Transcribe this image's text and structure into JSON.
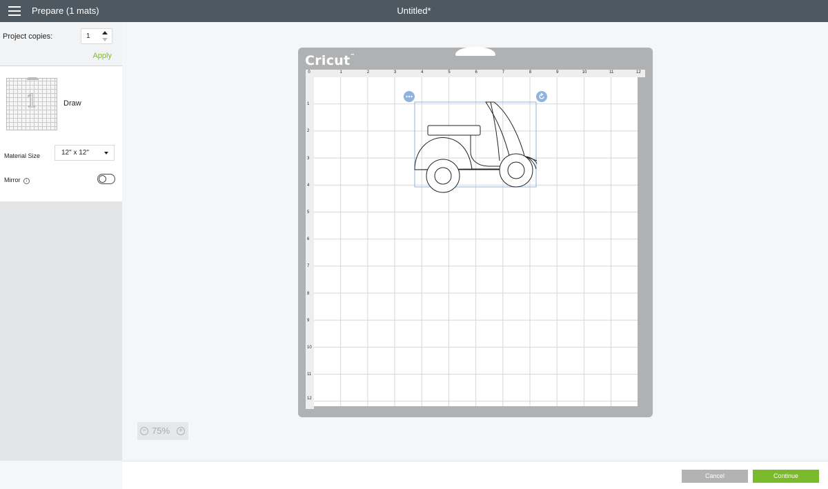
{
  "topbar": {
    "menu_title": "Prepare (1 mats)",
    "document_title": "Untitled*"
  },
  "sidebar": {
    "copies_label": "Project copies:",
    "copies_value": "1",
    "apply_label": "Apply",
    "mat": {
      "number": "1",
      "mode": "Draw"
    },
    "material_size_label": "Material Size",
    "material_size_value": "12\" x 12\"",
    "mirror_label": "Mirror",
    "mirror_on": false
  },
  "mat": {
    "logo": "Cricut",
    "ruler_x": [
      "0",
      "1",
      "2",
      "3",
      "4",
      "5",
      "6",
      "7",
      "8",
      "9",
      "10",
      "11",
      "12"
    ],
    "ruler_y": [
      "1",
      "2",
      "3",
      "4",
      "5",
      "6",
      "7",
      "8",
      "9",
      "10",
      "11",
      "12"
    ],
    "design_name": "scooter"
  },
  "zoom": {
    "minus": "−",
    "value": "75%",
    "plus": "+"
  },
  "footer": {
    "cancel_label": "Cancel",
    "continue_label": "Continue"
  },
  "colors": {
    "topbar": "#4e5861",
    "accent": "#79bb2b",
    "selection": "#8fb3de"
  }
}
